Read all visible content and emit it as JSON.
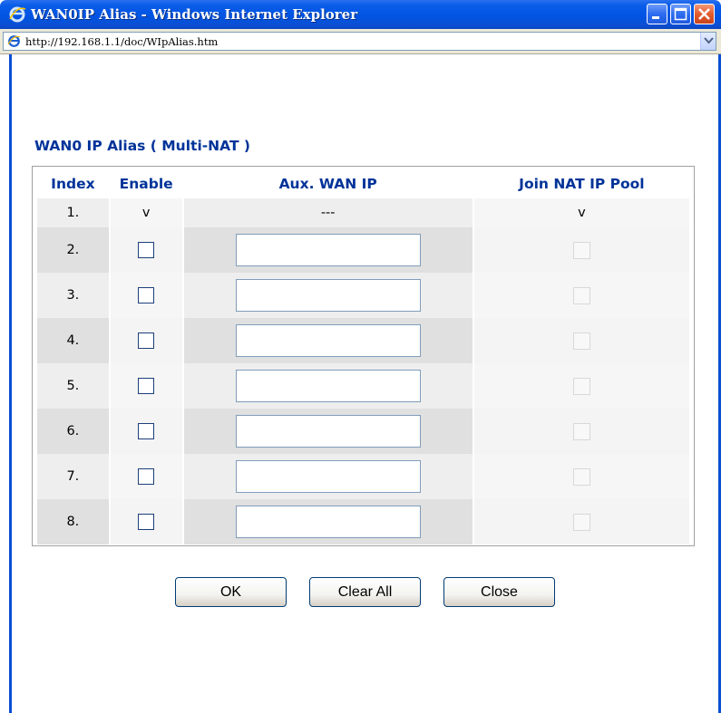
{
  "window": {
    "title": "WAN0IP Alias - Windows Internet Explorer",
    "icon": "ie-icon"
  },
  "address": {
    "url": "http://192.168.1.1/doc/WIpAlias.htm",
    "icon": "ie-page-icon"
  },
  "page": {
    "heading": "WAN0 IP Alias ( Multi-NAT )",
    "columns": {
      "index": "Index",
      "enable": "Enable",
      "aux_wan_ip": "Aux. WAN IP",
      "join_nat_pool": "Join NAT IP Pool"
    },
    "first_row": {
      "index": "1.",
      "enable": "v",
      "aux_wan_ip": "---",
      "join_nat_pool": "v"
    },
    "rows": [
      {
        "index": "2.",
        "enable": false,
        "aux_wan_ip": "",
        "join_nat_pool": false
      },
      {
        "index": "3.",
        "enable": false,
        "aux_wan_ip": "",
        "join_nat_pool": false
      },
      {
        "index": "4.",
        "enable": false,
        "aux_wan_ip": "",
        "join_nat_pool": false
      },
      {
        "index": "5.",
        "enable": false,
        "aux_wan_ip": "",
        "join_nat_pool": false
      },
      {
        "index": "6.",
        "enable": false,
        "aux_wan_ip": "",
        "join_nat_pool": false
      },
      {
        "index": "7.",
        "enable": false,
        "aux_wan_ip": "",
        "join_nat_pool": false
      },
      {
        "index": "8.",
        "enable": false,
        "aux_wan_ip": "",
        "join_nat_pool": false
      }
    ],
    "buttons": {
      "ok": "OK",
      "clear_all": "Clear All",
      "close": "Close"
    }
  },
  "colors": {
    "titlebar": "#0054e3",
    "heading_text": "#003399",
    "frame": "#0a4fd4"
  }
}
